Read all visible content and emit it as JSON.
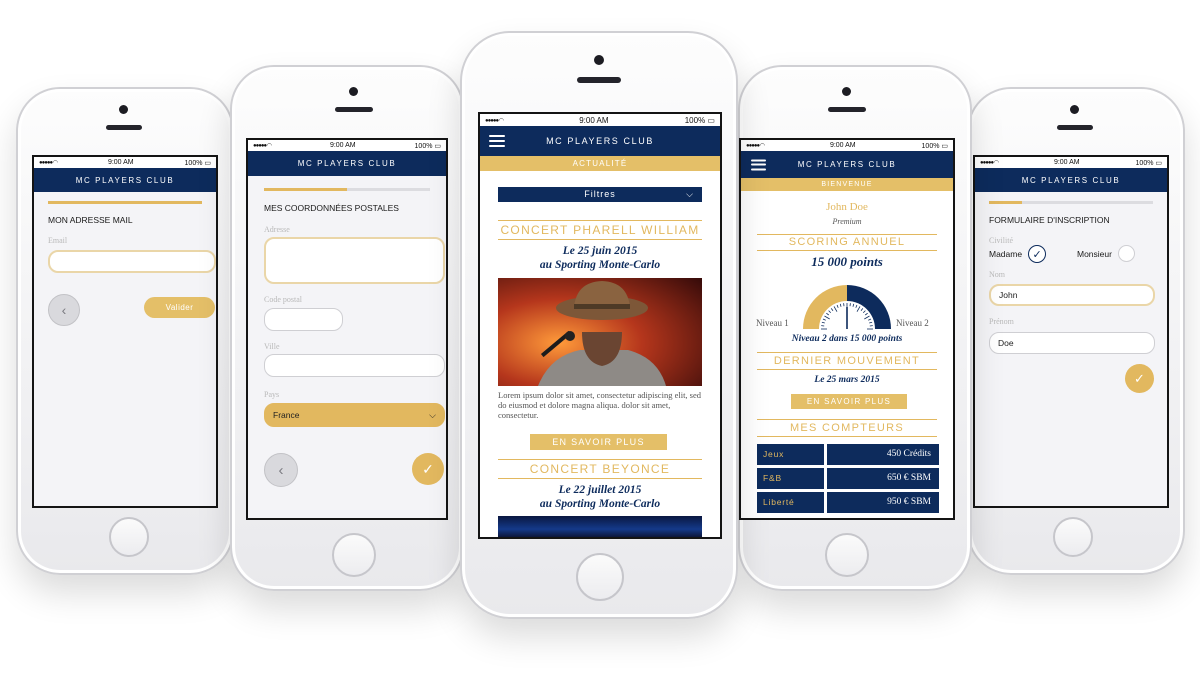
{
  "app_name": "MC PLAYERS CLUB",
  "status_bar": {
    "time": "9:00 AM",
    "battery": "100%"
  },
  "screen1": {
    "title": "MON ADRESSE MAIL",
    "email_label": "Email",
    "email_value": "",
    "back_icon": "chevron-left-icon",
    "submit_label": "Valider",
    "progress": 1.0
  },
  "screen2": {
    "title": "MES COORDONNÉES POSTALES",
    "progress": 0.5,
    "address_label": "Adresse",
    "postal_label": "Code postal",
    "city_label": "Ville",
    "country_label": "Pays",
    "country_value": "France"
  },
  "screen3": {
    "section": "ACTUALITÉ",
    "filter_label": "Filtres",
    "articles": [
      {
        "title": "CONCERT PHARELL WILLIAM",
        "date_line": "Le 25 juin 2015",
        "venue_line": "au Sporting Monte-Carlo",
        "body": "Lorem ipsum dolor sit amet, consectetur adipiscing elit, sed do eiusmod et dolore magna aliqua. dolor sit amet, consectetur.",
        "cta": "EN SAVOIR PLUS"
      },
      {
        "title": "CONCERT BEYONCE",
        "date_line": "Le 22 juillet 2015",
        "venue_line": "au Sporting Monte-Carlo"
      }
    ]
  },
  "screen4": {
    "section": "BIENVENUE",
    "user_name": "John Doe",
    "tier": "Premium",
    "scoring_title": "SCORING ANNUEL",
    "points": "15 000 points",
    "level_left": "Niveau 1",
    "level_right": "Niveau 2",
    "gauge_fraction": 0.5,
    "level_note": "Niveau 2 dans 15 000 points",
    "last_move_title": "DERNIER MOUVEMENT",
    "last_move_date": "Le 25 mars 2015",
    "cta": "EN SAVOIR PLUS",
    "counters_title": "MES COMPTEURS",
    "counters": [
      {
        "name": "Jeux",
        "value": "450 Crédits"
      },
      {
        "name": "F&B",
        "value": "650 € SBM"
      },
      {
        "name": "Liberté",
        "value": "950 € SBM"
      }
    ]
  },
  "screen5": {
    "title": "FORMULAIRE D'INSCRIPTION",
    "progress": 0.2,
    "civility_label": "Civilité",
    "option_madame": "Madame",
    "option_monsieur": "Monsieur",
    "lastname_label": "Nom",
    "lastname_value": "John",
    "firstname_label": "Prénom",
    "firstname_value": "Doe"
  },
  "colors": {
    "navy": "#0d2b5c",
    "gold": "#e2b85f",
    "background": "#f4f4f7"
  }
}
